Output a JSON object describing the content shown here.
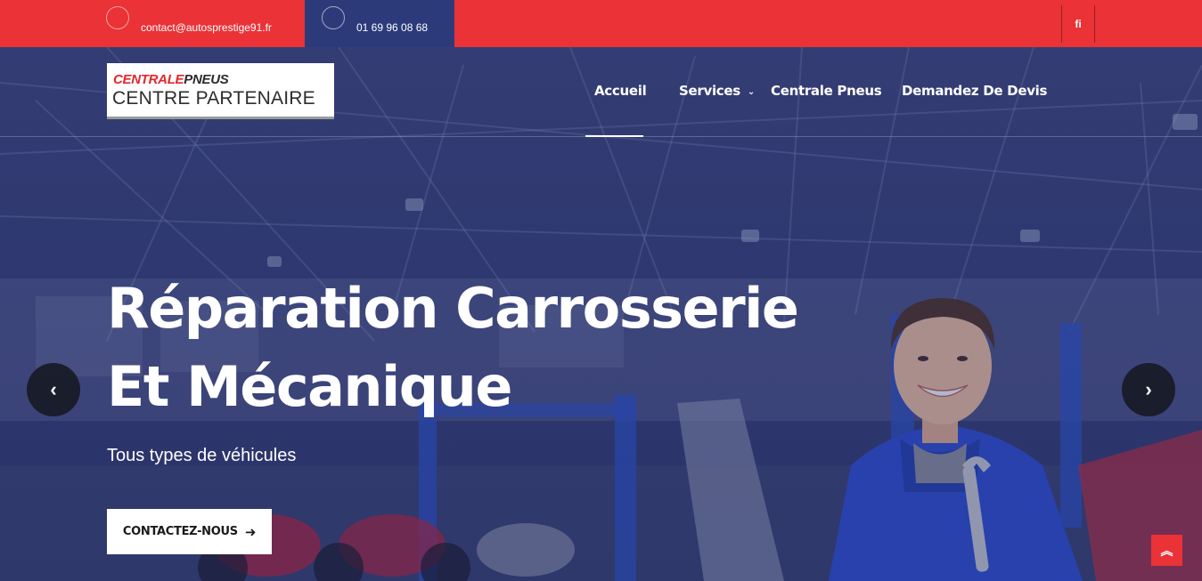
{
  "topbar": {
    "email": "contact@autosprestige91.fr",
    "phone": "01 69 96 08 68",
    "social_label": "fi"
  },
  "logo": {
    "top_red": "CENTRALE",
    "top_dark": "PNEUS",
    "bottom": "CENTRE PARTENAIRE"
  },
  "nav": {
    "items": [
      {
        "label": "Accueil"
      },
      {
        "label": "Services"
      },
      {
        "label": "Centrale Pneus"
      },
      {
        "label": "Demandez De Devis"
      }
    ]
  },
  "hero": {
    "title": "Réparation Carrosserie Et Mécanique",
    "subtitle": "Tous types de véhicules",
    "cta_label": "CONTACTEZ-NOUS"
  },
  "colors": {
    "accent": "#ea3237",
    "phone_block": "#2d3a7a",
    "hero_overlay": "#2b3466"
  },
  "icons": {
    "email": "circle-icon",
    "phone": "circle-icon",
    "prev": "chevron-left-icon",
    "next": "chevron-right-icon",
    "cta": "arrow-right-icon",
    "scroll": "double-chevron-up-icon"
  }
}
